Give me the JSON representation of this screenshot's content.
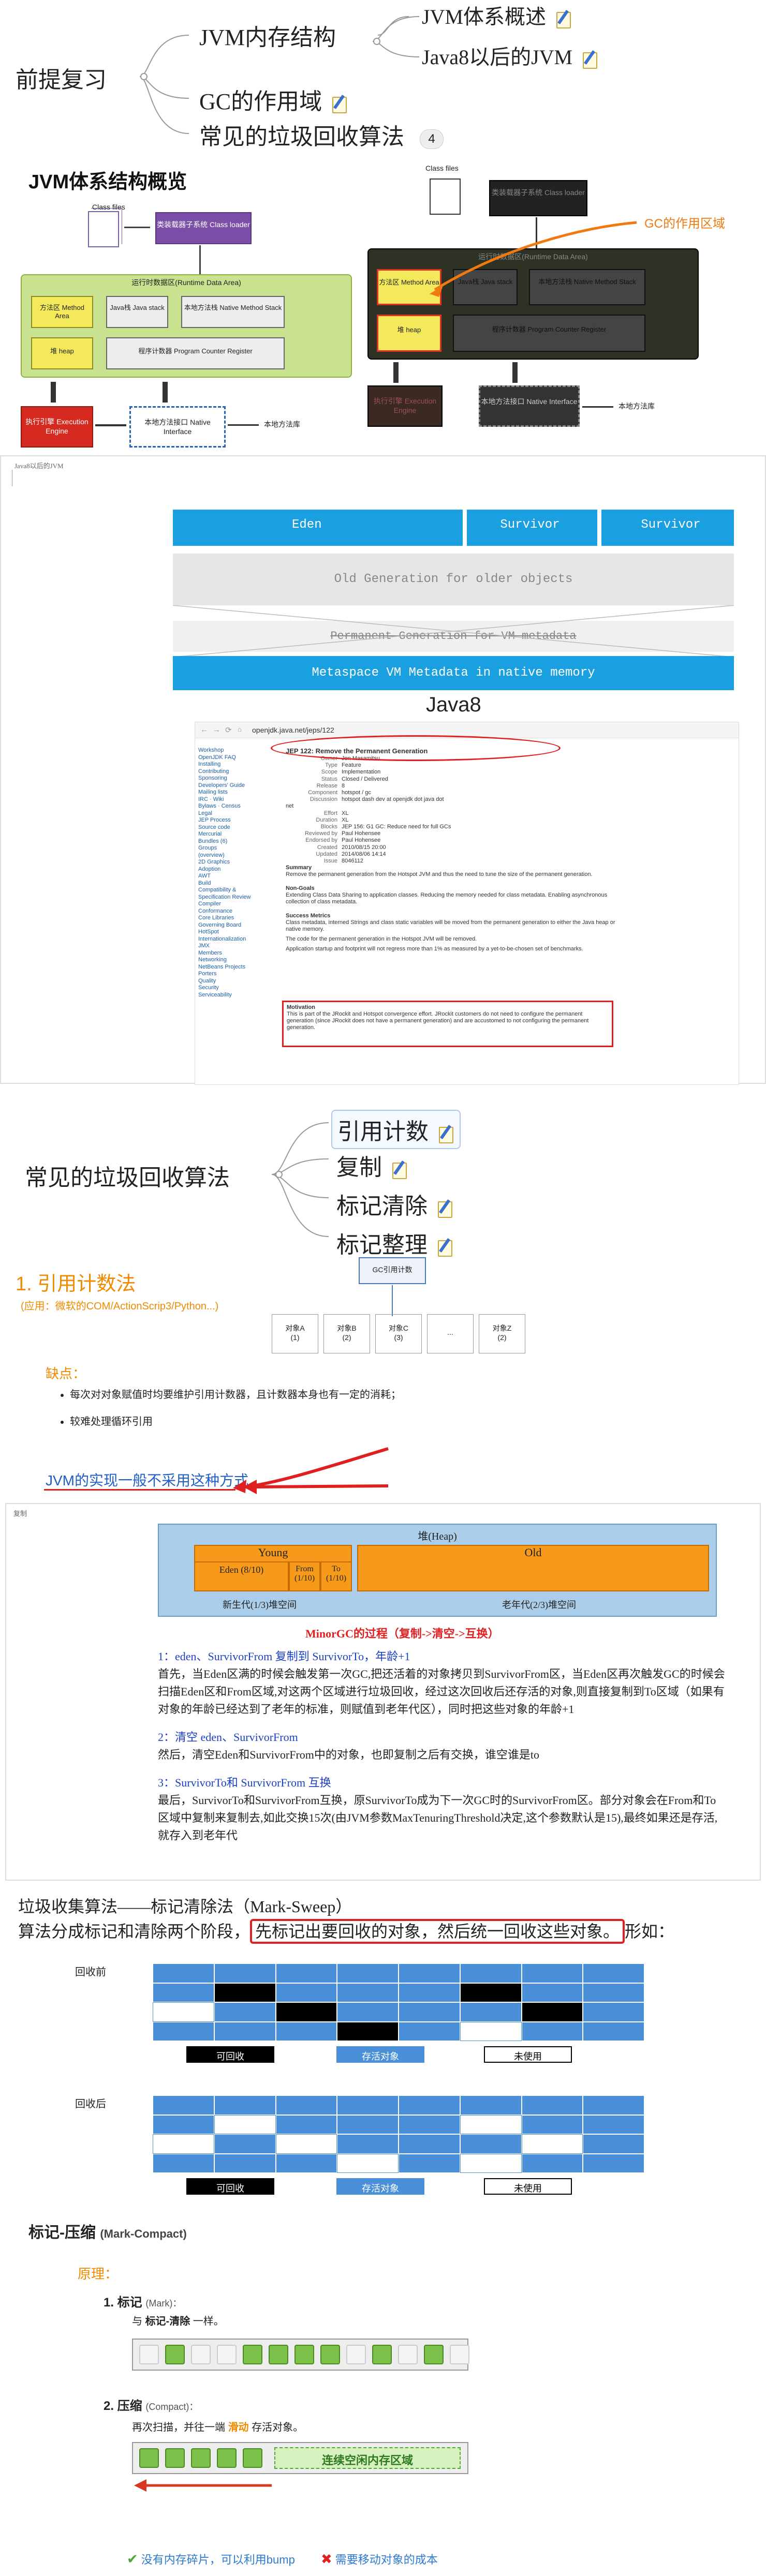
{
  "mindmap1": {
    "root": "前提复习",
    "branch1": "JVM内存结构",
    "sub1": "JVM体系概述",
    "sub2": "Java8以后的JVM",
    "branch2": "GC的作用域",
    "branch3": "常见的垃圾回收算法",
    "badge": "4"
  },
  "jvm_overview": {
    "title": "JVM体系结构概览",
    "class_files": "Class files",
    "class_loader": "类装载器子系统 Class loader",
    "runtime_area": "运行时数据区(Runtime Data Area)",
    "method_area": "方法区 Method Area",
    "java_stack": "Java栈 Java stack",
    "native_stack": "本地方法栈 Native Method Stack",
    "heap": "堆 heap",
    "pc_register": "程序计数器 Program Counter Register",
    "exec_engine": "执行引擎 Execution Engine",
    "native_interface": "本地方法接口 Native Interface",
    "native_lib": "本地方法库",
    "gc_scope_label": "GC的作用区域"
  },
  "java8": {
    "window_title": "Java8以后的JVM",
    "eden": "Eden",
    "survivor1": "Survivor",
    "survivor2": "Survivor",
    "old_gen": "Old Generation for older objects",
    "perm_gen": "Permanent Generation for VM metadata",
    "metaspace": "Metaspace VM Metadata in native memory",
    "caption": "Java8",
    "url": "openjdk.java.net/jeps/122",
    "jep_title": "JEP 122: Remove the Permanent Generation",
    "sidebar": [
      "Workshop",
      "OpenJDK FAQ",
      "Installing",
      "Contributing",
      "Sponsoring",
      "Developers' Guide",
      "Mailing lists",
      "IRC · Wiki",
      "Bylaws · Census",
      "Legal",
      "JEP Process",
      "Source code",
      "Mercurial",
      "Bundles (6)",
      "Groups",
      "(overview)",
      "2D Graphics",
      "Adoption",
      "AWT",
      "Build",
      "Compatibility & Specification Review",
      "Compiler",
      "Conformance",
      "Core Libraries",
      "Governing Board",
      "HotSpot",
      "Internationalization",
      "JMX",
      "Members",
      "Networking",
      "NetBeans Projects",
      "Porters",
      "Quality",
      "Security",
      "Serviceability"
    ],
    "meta": [
      [
        "Owner",
        "Jon Masamitsu"
      ],
      [
        "Type",
        "Feature"
      ],
      [
        "Scope",
        "Implementation"
      ],
      [
        "Status",
        "Closed / Delivered"
      ],
      [
        "Release",
        "8"
      ],
      [
        "Component",
        "hotspot / gc"
      ],
      [
        "Discussion",
        "hotspot dash dev at openjdk dot java dot net"
      ],
      [
        "Effort",
        "XL"
      ],
      [
        "Duration",
        "XL"
      ],
      [
        "Blocks",
        "JEP 156: G1 GC: Reduce need for full GCs"
      ],
      [
        "Reviewed by",
        "Paul Hohensee"
      ],
      [
        "Endorsed by",
        "Paul Hohensee"
      ],
      [
        "Created",
        "2010/08/15 20:00"
      ],
      [
        "Updated",
        "2014/08/06 14:14"
      ],
      [
        "Issue",
        "8046112"
      ]
    ],
    "summary_title": "Summary",
    "summary": "Remove the permanent generation from the Hotspot JVM and thus the need to tune the size of the permanent generation.",
    "nongoals_title": "Non-Goals",
    "nongoals": "Extending Class Data Sharing to application classes. Reducing the memory needed for class metadata. Enabling asynchronous collection of class metadata.",
    "metrics_title": "Success Metrics",
    "metrics": "Class metadata, interned Strings and class static variables will be moved from the permanent generation to either the Java heap or native memory.",
    "metrics2": "The code for the permanent generation in the Hotspot JVM will be removed.",
    "metrics3": "Application startup and footprint will not regress more than 1% as measured by a yet-to-be-chosen set of benchmarks.",
    "motivation_title": "Motivation",
    "motivation": "This is part of the JRockit and Hotspot convergence effort. JRockit customers do not need to configure the permanent generation (since JRockit does not have a permanent generation) and are accustomed to not configuring the permanent generation."
  },
  "mindmap2": {
    "root": "常见的垃圾回收算法",
    "items": [
      "引用计数",
      "复制",
      "标记清除",
      "标记整理"
    ]
  },
  "refcount": {
    "title": "1. 引用计数法",
    "subtitle": "(应用：微软的COM/ActionScrip3/Python...)",
    "counter_label": "GC引用计数",
    "objects": [
      [
        "对象A",
        "(1)"
      ],
      [
        "对象B",
        "(2)"
      ],
      [
        "对象C",
        "(3)"
      ],
      [
        "...",
        ""
      ],
      [
        "对象Z",
        "(2)"
      ]
    ],
    "cons_title": "缺点：",
    "cons": [
      "每次对对象赋值时均要维护引用计数器，且计数器本身也有一定的消耗；",
      "较难处理循环引用"
    ],
    "conclusion": "JVM的实现一般不采用这种方式"
  },
  "copy": {
    "window_title": "复制",
    "heap_title": "堆(Heap)",
    "young": "Young",
    "old": "Old",
    "eden": "Eden (8/10)",
    "from": "From (1/10)",
    "to": "To (1/10)",
    "young_caption": "新生代(1/3)堆空间",
    "old_caption": "老年代(2/3)堆空间",
    "minor_title": "MinorGC的过程（复制->清空->互换）",
    "s1_title": "1：eden、SurvivorFrom 复制到 SurvivorTo，年龄+1",
    "s1_body": "首先，当Eden区满的时候会触发第一次GC,把还活着的对象拷贝到SurvivorFrom区，当Eden区再次触发GC的时候会扫描Eden区和From区域,对这两个区域进行垃圾回收，经过这次回收后还存活的对象,则直接复制到To区域（如果有对象的年龄已经达到了老年的标准，则赋值到老年代区），同时把这些对象的年龄+1",
    "s2_title": "2：清空 eden、SurvivorFrom",
    "s2_body": "然后，清空Eden和SurvivorFrom中的对象，也即复制之后有交换，谁空谁是to",
    "s3_title": "3：SurvivorTo和 SurvivorFrom 互换",
    "s3_body": "最后，SurvivorTo和SurvivorFrom互换，原SurvivorTo成为下一次GC时的SurvivorFrom区。部分对象会在From和To区域中复制来复制去,如此交换15次(由JVM参数MaxTenuringThreshold决定,这个参数默认是15),最终如果还是存活,就存入到老年代"
  },
  "marksweep": {
    "line1": "垃圾收集算法——标记清除法（Mark-Sweep）",
    "line2a": "算法分成标记和清除两个阶段，",
    "line2b": "先标记出要回收的对象，然后统一回收这些对象。",
    "line2c": "形如：",
    "before": "回收前",
    "after": "回收后",
    "legend": [
      "可回收",
      "存活对象",
      "未使用"
    ],
    "colors": {
      "recyclable": "#000000",
      "alive": "#4a90d9",
      "unused": "#ffffff"
    }
  },
  "markcompact": {
    "title": "标记-压缩",
    "title_en": "(Mark-Compact)",
    "principle": "原理：",
    "step1": "1.  标记",
    "step1_en": "(Mark)：",
    "step1_desc_a": "与",
    "step1_desc_b": "标记-清除",
    "step1_desc_c": "一样。",
    "step2": "2.  压缩",
    "step2_en": "(Compact)：",
    "step2_desc_a": "再次扫描，并往一端",
    "step2_desc_b": "滑动",
    "step2_desc_c": "存活对象。",
    "free_label": "连续空闲内存区域",
    "pro": "没有内存碎片，可以利用bump",
    "con": "需要移动对象的成本"
  }
}
